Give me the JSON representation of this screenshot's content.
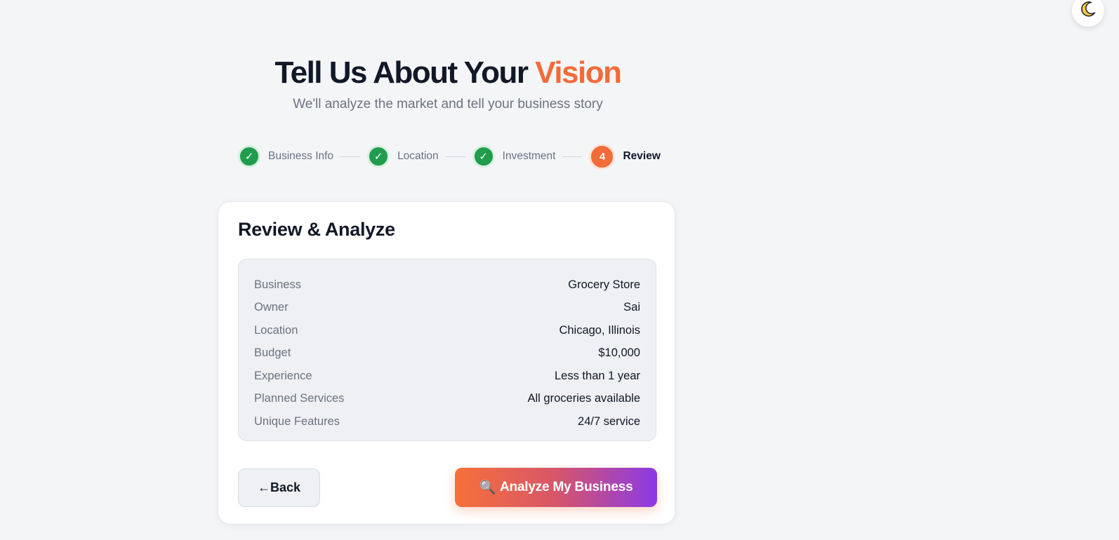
{
  "theme_toggle": {
    "icon": "moon-icon",
    "glyph": "🌙"
  },
  "hero": {
    "title_main": "Tell Us About Your ",
    "title_accent": "Vision",
    "subtitle": "We'll analyze the market and tell your business story"
  },
  "stepper": {
    "steps": [
      {
        "label": "Business Info",
        "status": "complete",
        "glyph": "✓"
      },
      {
        "label": "Location",
        "status": "complete",
        "glyph": "✓"
      },
      {
        "label": "Investment",
        "status": "complete",
        "glyph": "✓"
      },
      {
        "label": "Review",
        "status": "active",
        "glyph": "4"
      }
    ]
  },
  "card": {
    "title": "Review & Analyze",
    "rows": [
      {
        "key": "Business",
        "value": "Grocery Store"
      },
      {
        "key": "Owner",
        "value": "Sai"
      },
      {
        "key": "Location",
        "value": "Chicago, Illinois"
      },
      {
        "key": "Budget",
        "value": "$10,000"
      },
      {
        "key": "Experience",
        "value": "Less than 1 year"
      },
      {
        "key": "Planned Services",
        "value": "All groceries available"
      },
      {
        "key": "Unique Features",
        "value": "24/7 service"
      }
    ],
    "back_label": "←Back",
    "analyze_icon": "🔍",
    "analyze_label": "Analyze My Business"
  },
  "colors": {
    "accent": "#f26b38",
    "complete": "#1f9d4d",
    "gradient_end": "#8a3ae6"
  }
}
